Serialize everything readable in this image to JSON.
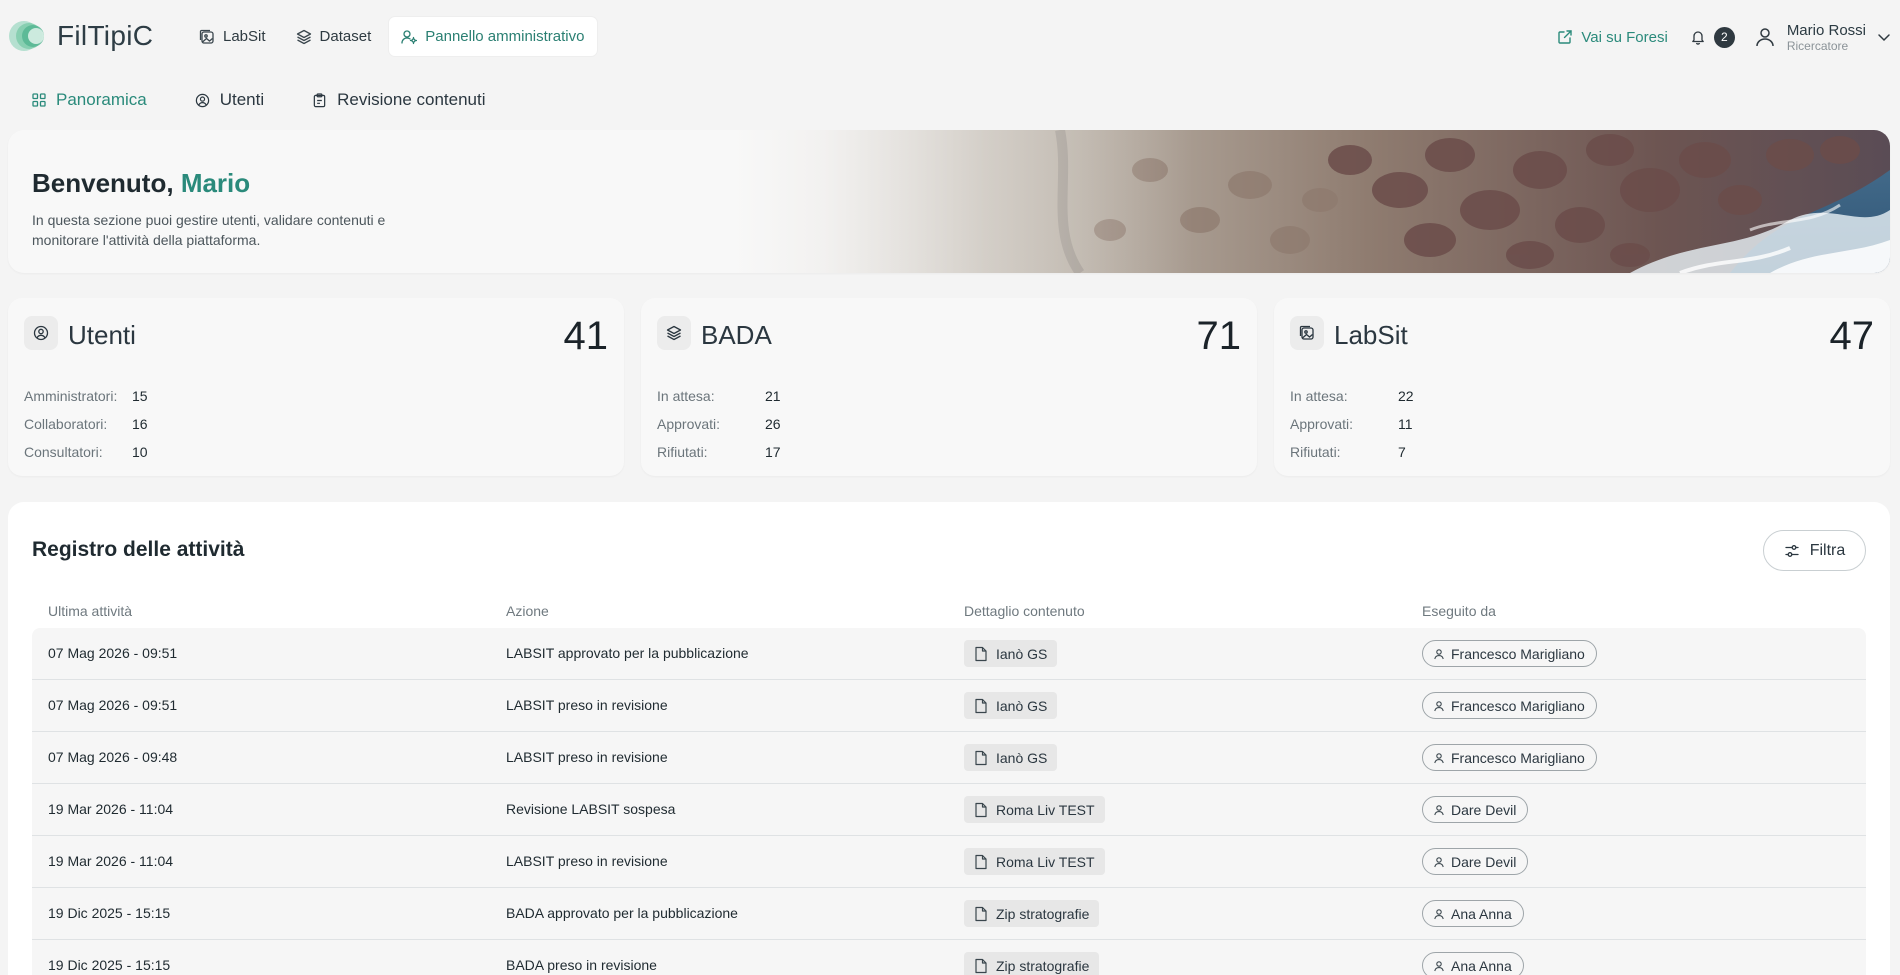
{
  "app": {
    "name": "FilTipiC",
    "accent_color": "#2a8a7b"
  },
  "topnav": {
    "items": [
      {
        "label": "LabSit",
        "icon": "image-icon"
      },
      {
        "label": "Dataset",
        "icon": "layers-icon"
      },
      {
        "label": "Pannello amministrativo",
        "icon": "user-settings-icon",
        "active": true
      }
    ],
    "external_link": "Vai su Foresi",
    "notifications_count": "2",
    "user": {
      "name": "Mario Rossi",
      "role": "Ricercatore"
    }
  },
  "subtabs": [
    {
      "label": "Panoramica",
      "icon": "grid-icon",
      "active": true
    },
    {
      "label": "Utenti",
      "icon": "user-circle-icon"
    },
    {
      "label": "Revisione contenuti",
      "icon": "clipboard-icon"
    }
  ],
  "hero": {
    "greeting": "Benvenuto,",
    "name": "Mario",
    "description": "In questa sezione puoi gestire utenti, validare contenuti e monitorare l'attività della piattaforma."
  },
  "stats": [
    {
      "title": "Utenti",
      "icon": "user-circle-icon",
      "total": "41",
      "rows": [
        {
          "label": "Amministratori:",
          "value": "15"
        },
        {
          "label": "Collaboratori:",
          "value": "16"
        },
        {
          "label": "Consultatori:",
          "value": "10"
        }
      ]
    },
    {
      "title": "BADA",
      "icon": "layers-icon",
      "total": "71",
      "rows": [
        {
          "label": "In attesa:",
          "value": "21"
        },
        {
          "label": "Approvati:",
          "value": "26"
        },
        {
          "label": "Rifiutati:",
          "value": "17"
        }
      ]
    },
    {
      "title": "LabSit",
      "icon": "image-icon",
      "total": "47",
      "rows": [
        {
          "label": "In attesa:",
          "value": "22"
        },
        {
          "label": "Approvati:",
          "value": "11"
        },
        {
          "label": "Rifiutati:",
          "value": "7"
        }
      ]
    }
  ],
  "log": {
    "title": "Registro delle attività",
    "filter_label": "Filtra",
    "columns": [
      "Ultima attività",
      "Azione",
      "Dettaglio contenuto",
      "Eseguito da"
    ],
    "rows": [
      {
        "date": "07 Mag 2026 - 09:51",
        "action": "LABSIT approvato per la pubblicazione",
        "content": "Ianò GS",
        "user": "Francesco Marigliano"
      },
      {
        "date": "07 Mag 2026 - 09:51",
        "action": "LABSIT preso in revisione",
        "content": "Ianò GS",
        "user": "Francesco Marigliano"
      },
      {
        "date": "07 Mag 2026 - 09:48",
        "action": "LABSIT preso in revisione",
        "content": "Ianò GS",
        "user": "Francesco Marigliano"
      },
      {
        "date": "19 Mar 2026 - 11:04",
        "action": "Revisione LABSIT sospesa",
        "content": "Roma Liv TEST",
        "user": "Dare Devil"
      },
      {
        "date": "19 Mar 2026 - 11:04",
        "action": "LABSIT preso in revisione",
        "content": "Roma Liv TEST",
        "user": "Dare Devil"
      },
      {
        "date": "19 Dic 2025 - 15:15",
        "action": "BADA approvato per la pubblicazione",
        "content": "Zip stratografie",
        "user": "Ana Anna"
      },
      {
        "date": "19 Dic 2025 - 15:15",
        "action": "BADA preso in revisione",
        "content": "Zip stratografie",
        "user": "Ana Anna"
      }
    ]
  }
}
